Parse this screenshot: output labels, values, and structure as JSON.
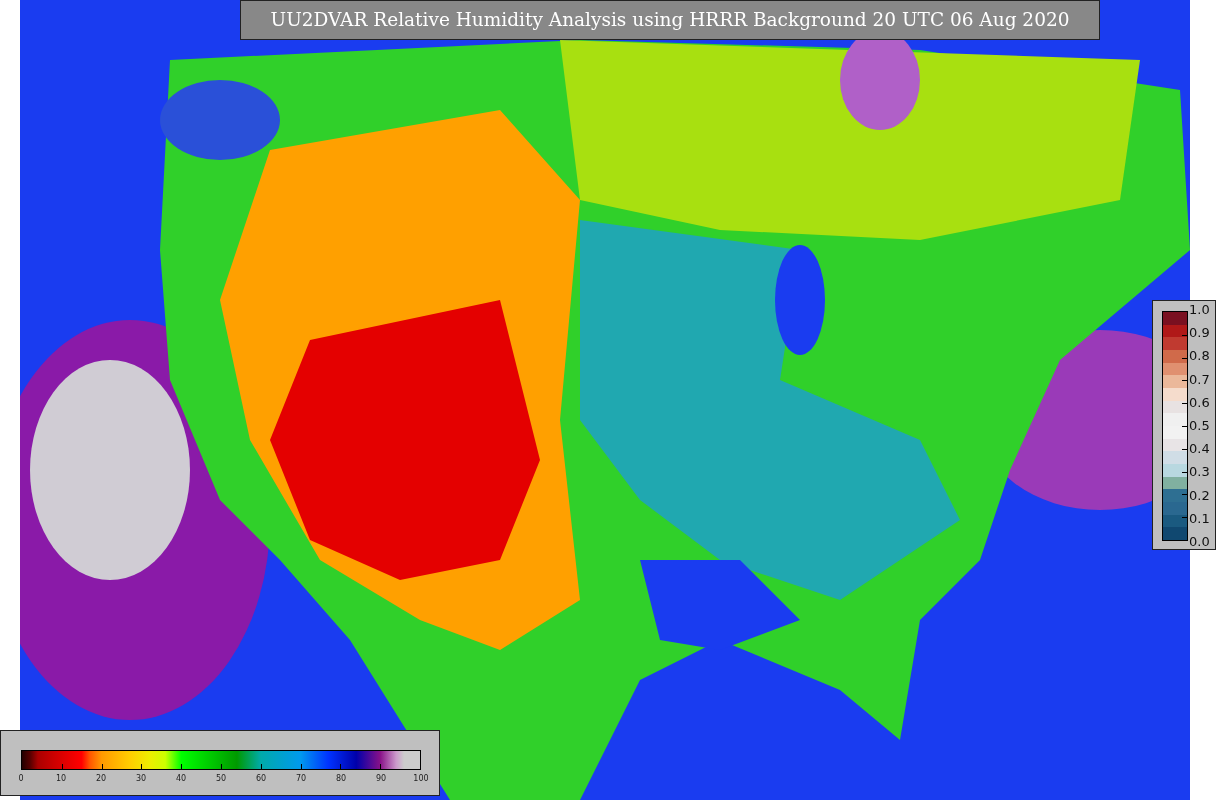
{
  "title": "UU2DVAR Relative Humidity Analysis using HRRR Background 20 UTC 06 Aug 2020",
  "colorbar_right": {
    "ticks": [
      "1.0",
      "0.9",
      "0.8",
      "0.7",
      "0.6",
      "0.5",
      "0.4",
      "0.3",
      "0.2",
      "0.1",
      "0.0"
    ]
  },
  "colorbar_bottom": {
    "ticks": [
      "0",
      "10",
      "20",
      "30",
      "40",
      "50",
      "60",
      "70",
      "80",
      "90",
      "100"
    ]
  }
}
